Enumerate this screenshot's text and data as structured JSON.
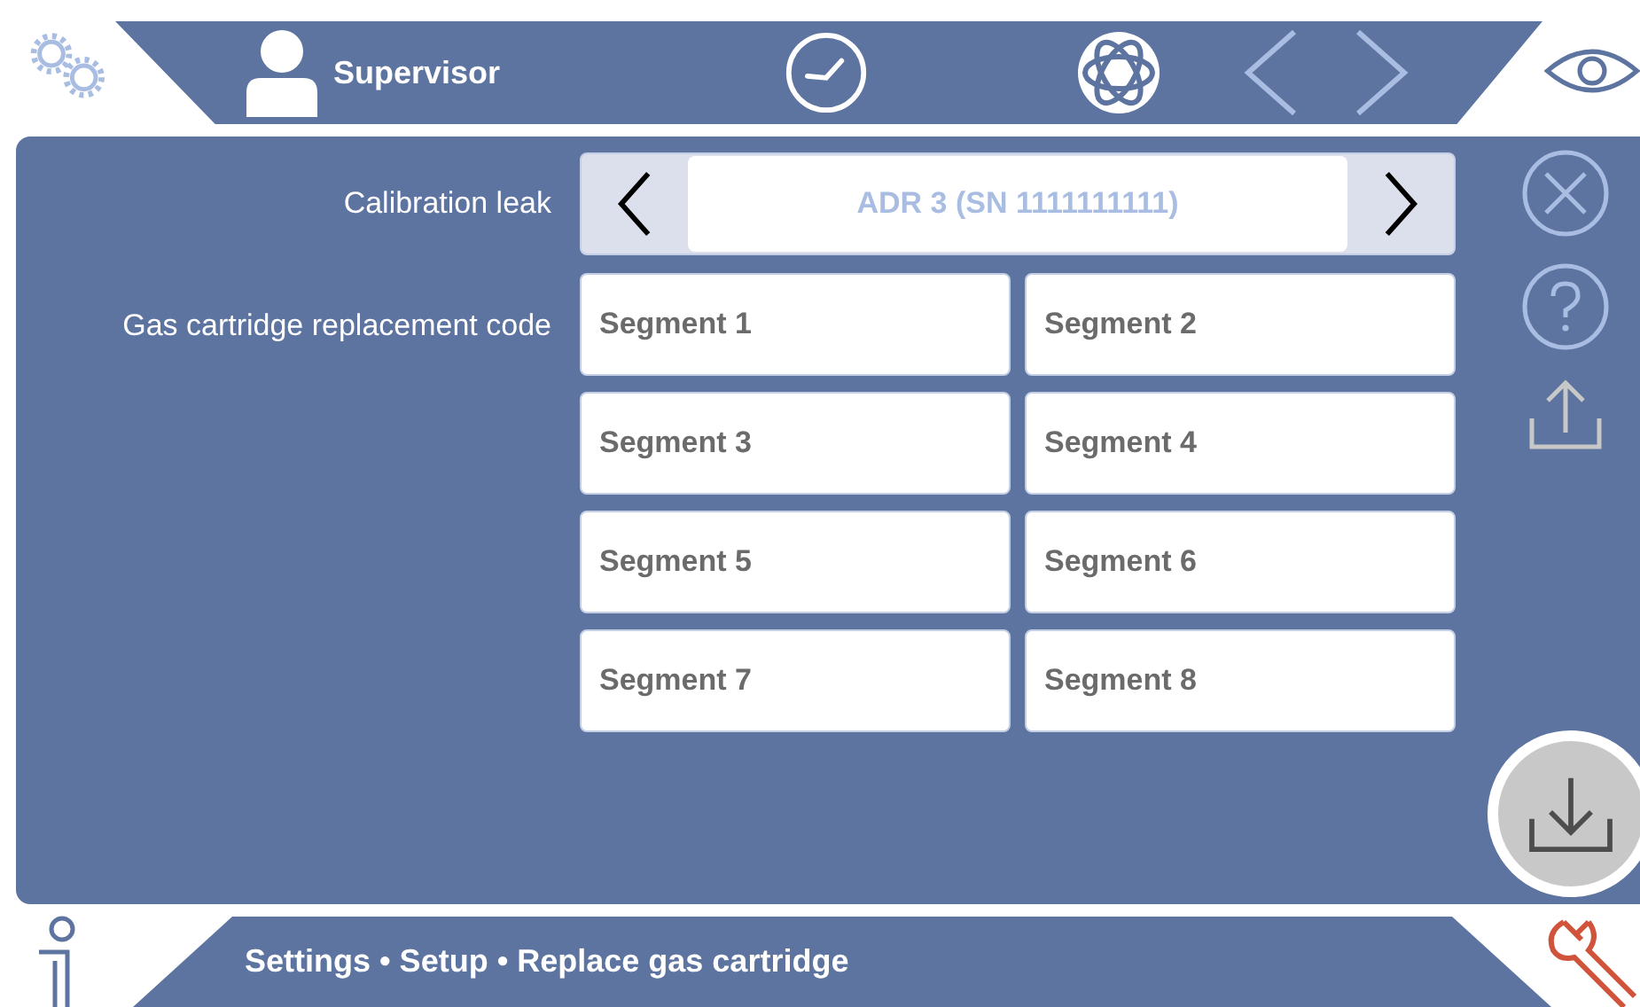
{
  "header": {
    "user": "Supervisor",
    "back_disabled": true,
    "forward_disabled": true
  },
  "form": {
    "calibration_leak": {
      "label": "Calibration leak",
      "value": "ADR 3 (SN 1111111111)"
    },
    "replacement_code": {
      "label": "Gas cartridge replacement code",
      "segments": [
        {
          "placeholder": "Segment 1"
        },
        {
          "placeholder": "Segment 2"
        },
        {
          "placeholder": "Segment 3"
        },
        {
          "placeholder": "Segment 4"
        },
        {
          "placeholder": "Segment 5"
        },
        {
          "placeholder": "Segment 6"
        },
        {
          "placeholder": "Segment 7"
        },
        {
          "placeholder": "Segment 8"
        }
      ]
    }
  },
  "footer": {
    "breadcrumb": "Settings • Setup • Replace gas cartridge"
  }
}
